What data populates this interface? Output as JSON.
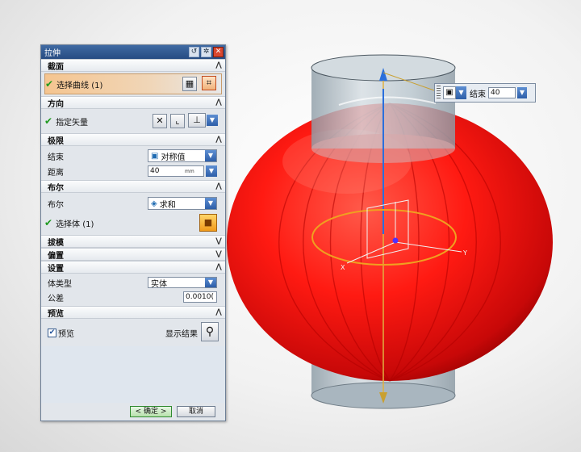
{
  "window": {
    "title": "拉伸"
  },
  "titlebar_icons": [
    "reset-icon",
    "gear-icon",
    "close-icon"
  ],
  "sections": {
    "section": {
      "title": "截面",
      "select_curve_label": "选择曲线 (1)"
    },
    "direction": {
      "title": "方向",
      "specify_vector_label": "指定矢量"
    },
    "limits": {
      "title": "极限",
      "end_label": "结束",
      "end_value": "对称值",
      "distance_label": "距离",
      "distance_value": "40",
      "distance_unit": "mm"
    },
    "boolean": {
      "title": "布尔",
      "boolean_label": "布尔",
      "boolean_value": "求和",
      "select_body_label": "选择体 (1)"
    },
    "draft": {
      "title": "拔模"
    },
    "offset": {
      "title": "偏置"
    },
    "settings": {
      "title": "设置",
      "body_type_label": "体类型",
      "body_type_value": "实体",
      "tolerance_label": "公差",
      "tolerance_value": "0.0010("
    },
    "preview": {
      "title": "预览",
      "preview_checkbox_label": "预览",
      "preview_checked": true,
      "show_result_label": "显示结果"
    }
  },
  "buttons": {
    "ok": "< 确定 >",
    "cancel": "取消"
  },
  "end_widget": {
    "label": "结束",
    "value": "40"
  },
  "viewport": {
    "lantern_color": "#ff1a12",
    "cylinder_color": "#b9c6cf",
    "axis_color": "#2a6fdc",
    "section_circle_color": "#f0a020",
    "triad_labels": {
      "x": "X",
      "y": "Y"
    }
  }
}
